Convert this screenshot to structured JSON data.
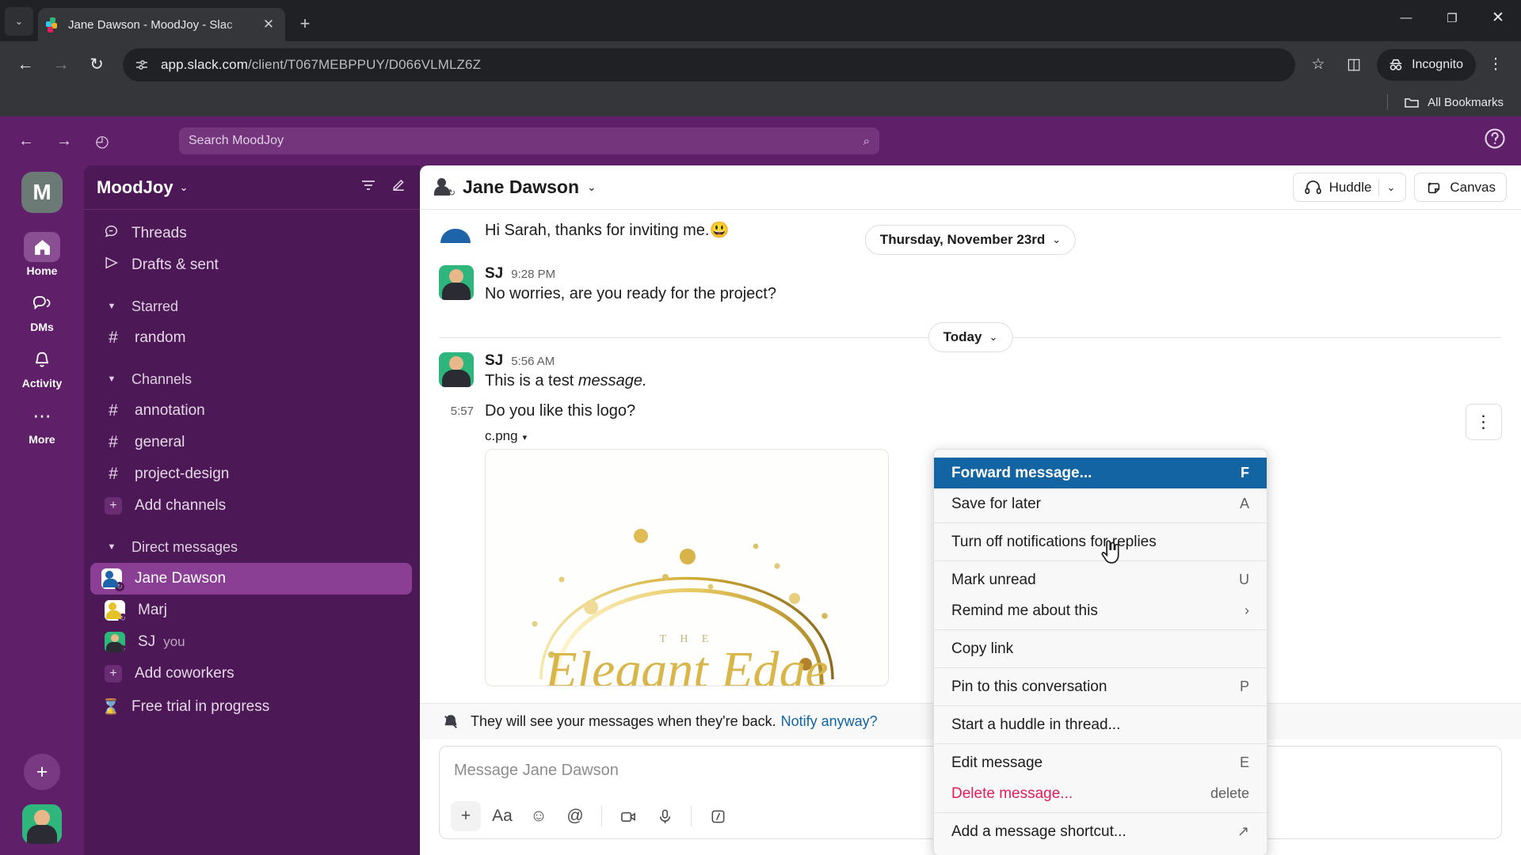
{
  "browser": {
    "tab": {
      "title": "Jane Dawson - MoodJoy - Slac",
      "favicon": "slack-logo-icon",
      "close_label": "✕"
    },
    "new_tab_label": "+",
    "tab_list_chevron": "⌄",
    "window_controls": {
      "minimize": "—",
      "maximize": "❐",
      "close": "✕"
    },
    "nav": {
      "back": "←",
      "forward": "→",
      "reload": "↻"
    },
    "omnibox": {
      "url_host": "app.slack.com",
      "url_path": "/client/T067MEBPPUY/D066VLMLZ6Z"
    },
    "star_label": "☆",
    "side_panel_label": "◫",
    "incognito_label": "Incognito",
    "menu_label": "⋮",
    "bookmarks_label": "All Bookmarks"
  },
  "slack": {
    "topbar": {
      "back": "←",
      "forward": "→",
      "history": "◴",
      "search_placeholder": "Search MoodJoy",
      "search_icon": "⌕",
      "help": "?"
    },
    "rail": {
      "workspace_initial": "M",
      "items": [
        {
          "label": "Home",
          "icon": "home-icon",
          "active": true
        },
        {
          "label": "DMs",
          "icon": "dms-icon",
          "active": false
        },
        {
          "label": "Activity",
          "icon": "bell-icon",
          "active": false
        },
        {
          "label": "More",
          "icon": "more-dots-icon",
          "active": false
        }
      ],
      "add_label": "+"
    },
    "sidebar": {
      "workspace_name": "MoodJoy",
      "caret": "⌄",
      "filter_icon": "☲",
      "compose_icon": "✎",
      "nav": [
        {
          "label": "Threads",
          "icon": "threads-icon"
        },
        {
          "label": "Drafts & sent",
          "icon": "drafts-icon"
        }
      ],
      "sections": [
        {
          "label": "Starred",
          "items": [
            {
              "label": "random",
              "type": "channel"
            }
          ]
        },
        {
          "label": "Channels",
          "items": [
            {
              "label": "annotation",
              "type": "channel"
            },
            {
              "label": "general",
              "type": "channel"
            },
            {
              "label": "project-design",
              "type": "channel"
            },
            {
              "label": "Add channels",
              "type": "add"
            }
          ]
        },
        {
          "label": "Direct messages",
          "items": [
            {
              "label": "Jane Dawson",
              "type": "dm",
              "avatar": "blue",
              "active": true
            },
            {
              "label": "Marj",
              "type": "dm",
              "avatar": "yel",
              "active": false
            },
            {
              "label": "SJ",
              "type": "dm",
              "avatar": "grn",
              "suffix": "you",
              "active": false
            },
            {
              "label": "Add coworkers",
              "type": "add"
            }
          ]
        }
      ],
      "trial": {
        "label": "Free trial in progress",
        "icon": "hourglass-icon"
      }
    },
    "channel": {
      "name": "Jane Dawson",
      "caret": "⌄",
      "huddle_label": "Huddle",
      "huddle_caret": "⌄",
      "canvas_label": "Canvas"
    },
    "messages": [
      {
        "id": "m1",
        "avatar": "blue-cloud",
        "text": "Hi Sarah, thanks for inviting me.",
        "emoji": "😃",
        "compact": true
      },
      {
        "id": "m2",
        "avatar": "green",
        "name": "SJ",
        "time": "9:28 PM",
        "text": "No worries, are you ready for the project?"
      },
      {
        "id": "m3",
        "avatar": "green",
        "name": "SJ",
        "time": "5:56 AM",
        "text_plain": "This is a test ",
        "text_italic": "message."
      },
      {
        "id": "m4",
        "gutter_time": "5:57",
        "text": "Do you like this logo?",
        "file_name": "c.png",
        "file_caret": "▾",
        "logo_text": "T  H  E"
      }
    ],
    "date_dividers": [
      {
        "label": "Thursday, November 23rd",
        "caret": "⌄"
      },
      {
        "label": "Today",
        "caret": "⌄"
      }
    ],
    "hover_toolbar_icon": "⋮",
    "notify_bar": {
      "icon": "bell-off-icon",
      "text": "They will see your messages when they're back.",
      "link": "Notify anyway?"
    },
    "composer": {
      "placeholder": "Message Jane Dawson",
      "tools": [
        {
          "name": "plus-icon",
          "glyph": "+"
        },
        {
          "name": "format-text-icon",
          "glyph": "Aa"
        },
        {
          "name": "emoji-icon",
          "glyph": "☺"
        },
        {
          "name": "mention-icon",
          "glyph": "@"
        },
        {
          "name": "video-icon",
          "glyph": "▷"
        },
        {
          "name": "microphone-icon",
          "glyph": "⚉"
        },
        {
          "name": "slash-command-icon",
          "glyph": "/"
        }
      ]
    },
    "context_menu": {
      "groups": [
        {
          "items": [
            {
              "label": "Forward message...",
              "shortcut": "F",
              "selected": true
            },
            {
              "label": "Save for later",
              "shortcut": "A"
            }
          ]
        },
        {
          "items": [
            {
              "label": "Turn off notifications for replies",
              "shortcut": ""
            }
          ]
        },
        {
          "items": [
            {
              "label": "Mark unread",
              "shortcut": "U"
            },
            {
              "label": "Remind me about this",
              "shortcut": "›"
            }
          ]
        },
        {
          "items": [
            {
              "label": "Copy link",
              "shortcut": ""
            }
          ]
        },
        {
          "items": [
            {
              "label": "Pin to this conversation",
              "shortcut": "P"
            }
          ]
        },
        {
          "items": [
            {
              "label": "Start a huddle in thread...",
              "shortcut": ""
            }
          ]
        },
        {
          "items": [
            {
              "label": "Edit message",
              "shortcut": "E"
            },
            {
              "label": "Delete message...",
              "shortcut": "delete",
              "danger": true
            }
          ]
        },
        {
          "items": [
            {
              "label": "Add a message shortcut...",
              "shortcut": "↗"
            }
          ]
        }
      ]
    }
  },
  "colors": {
    "slack_aubergine": "#4d1856",
    "slack_purple_bar": "#601f69",
    "selected_dm": "#8a3e94",
    "menu_selected": "#1264a3",
    "danger": "#e01e5a",
    "link": "#1264a3"
  }
}
